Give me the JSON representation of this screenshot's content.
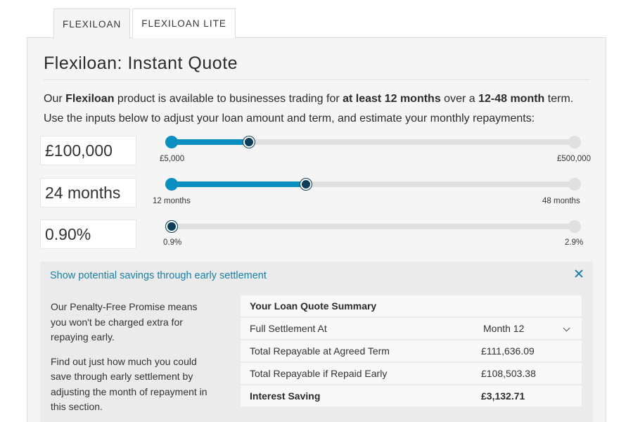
{
  "tabs": [
    {
      "label": "FLEXILOAN",
      "active": true
    },
    {
      "label": "FLEXILOAN LITE",
      "active": false
    }
  ],
  "panel": {
    "title": "Flexiloan: Instant Quote",
    "intro": {
      "line1_a": "Our ",
      "line1_b": "Flexiloan",
      "line1_c": " product is available to businesses trading for ",
      "line1_d": "at least 12 months",
      "line1_e": " over a ",
      "line1_f": "12-48 month",
      "line1_g": " term.",
      "line2": "Use the inputs below to adjust your loan amount and term, and estimate your monthly repayments:"
    }
  },
  "sliders": {
    "amount": {
      "display": "£100,000",
      "value": 100000,
      "min": 5000,
      "max": 500000,
      "min_label": "£5,000",
      "max_label": "£500,000"
    },
    "term": {
      "display": "24 months",
      "value": 24,
      "min": 12,
      "max": 48,
      "min_label": "12 months",
      "max_label": "48 months"
    },
    "rate": {
      "display": "0.90%",
      "value": 0.9,
      "min": 0.9,
      "max": 2.9,
      "min_label": "0.9%",
      "max_label": "2.9%"
    }
  },
  "savings": {
    "toggle_label": "Show potential savings through early settlement",
    "para1": "Our Penalty-Free Promise means you won't be charged extra for repaying early.",
    "para2": "Find out just how much you could save through early settlement by adjusting the month of repayment in this section.",
    "summary": {
      "title": "Your Loan Quote Summary",
      "rows": [
        {
          "label": "Full Settlement At",
          "value": "Month 12"
        },
        {
          "label": "Total Repayable at Agreed Term",
          "value": "£111,636.09"
        },
        {
          "label": "Total Repayable if Repaid Early",
          "value": "£108,503.38"
        },
        {
          "label": "Interest Saving",
          "value": "£3,132.71"
        }
      ]
    }
  },
  "colors": {
    "accent": "#0a8fc0",
    "handle": "#0e3f5a",
    "link": "#1a7fa6"
  }
}
